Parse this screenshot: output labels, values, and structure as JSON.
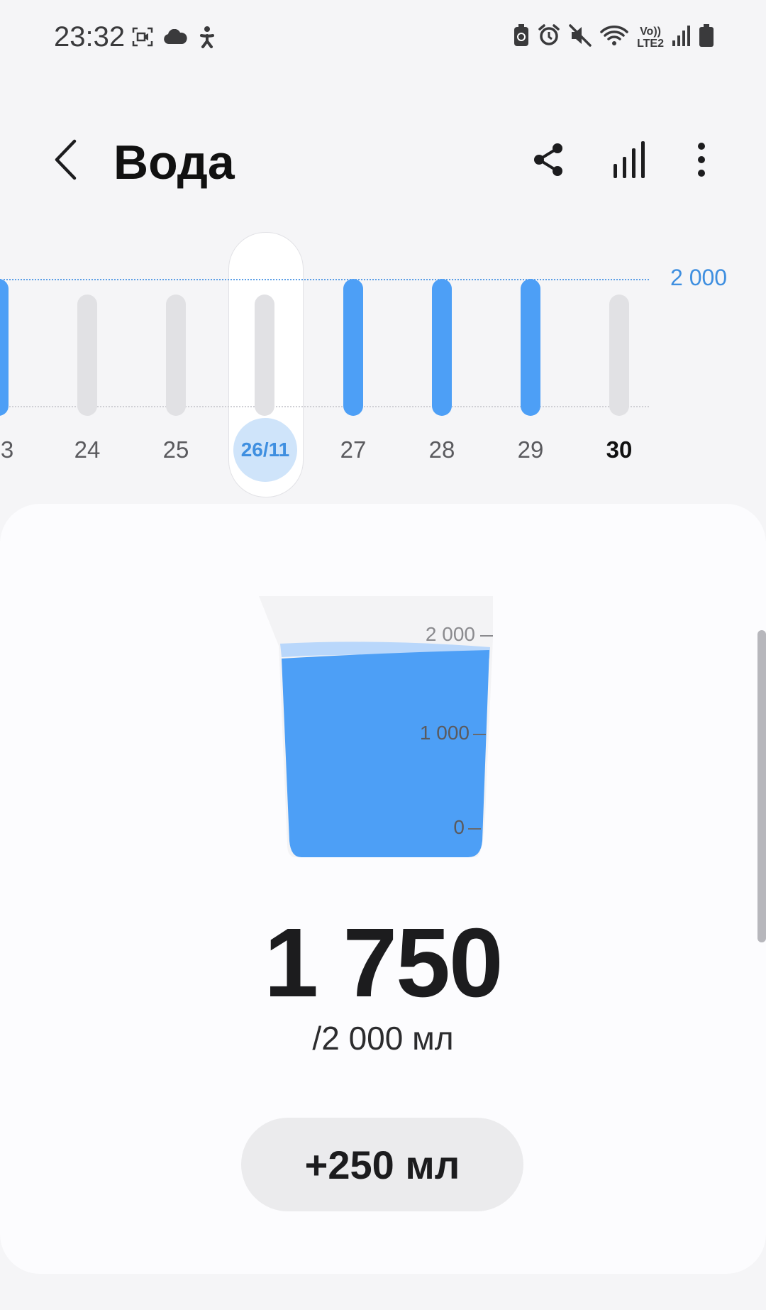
{
  "status_bar": {
    "time": "23:32",
    "left_icons": [
      "screen-record-icon",
      "cloud-icon",
      "accessibility-icon"
    ],
    "right_icons": [
      "battery-saver-icon",
      "alarm-icon",
      "mute-icon",
      "wifi-icon",
      "volte-lte2-icon",
      "signal-icon",
      "battery-icon"
    ],
    "lte_top": "Vo))",
    "lte_bottom": "LTE2"
  },
  "header": {
    "title": "Вода",
    "back_icon": "chevron-left-icon",
    "action_icons": [
      "share-icon",
      "chart-icon",
      "more-vert-icon"
    ]
  },
  "week_chart": {
    "goal_label": "2 000",
    "selected_label": "26/11",
    "days": [
      {
        "label": "3",
        "value": 2000,
        "filled": true
      },
      {
        "label": "24",
        "value": 0,
        "filled": false
      },
      {
        "label": "25",
        "value": 0,
        "filled": false
      },
      {
        "label": "26/11",
        "value": 0,
        "filled": false,
        "selected": true
      },
      {
        "label": "27",
        "value": 2000,
        "filled": true
      },
      {
        "label": "28",
        "value": 2000,
        "filled": true
      },
      {
        "label": "29",
        "value": 2000,
        "filled": true
      },
      {
        "label": "30",
        "value": 0,
        "filled": false,
        "today": true
      }
    ],
    "colors": {
      "filled": "#4d9ff6",
      "empty": "#e1e1e4",
      "goal": "#3f8fe0"
    }
  },
  "intake": {
    "cup_ticks": [
      "2 000",
      "1 000",
      "0"
    ],
    "current": "1 750",
    "goal_text": "/2 000 мл",
    "fill_fraction": 0.875,
    "add_button": "+250 мл"
  }
}
